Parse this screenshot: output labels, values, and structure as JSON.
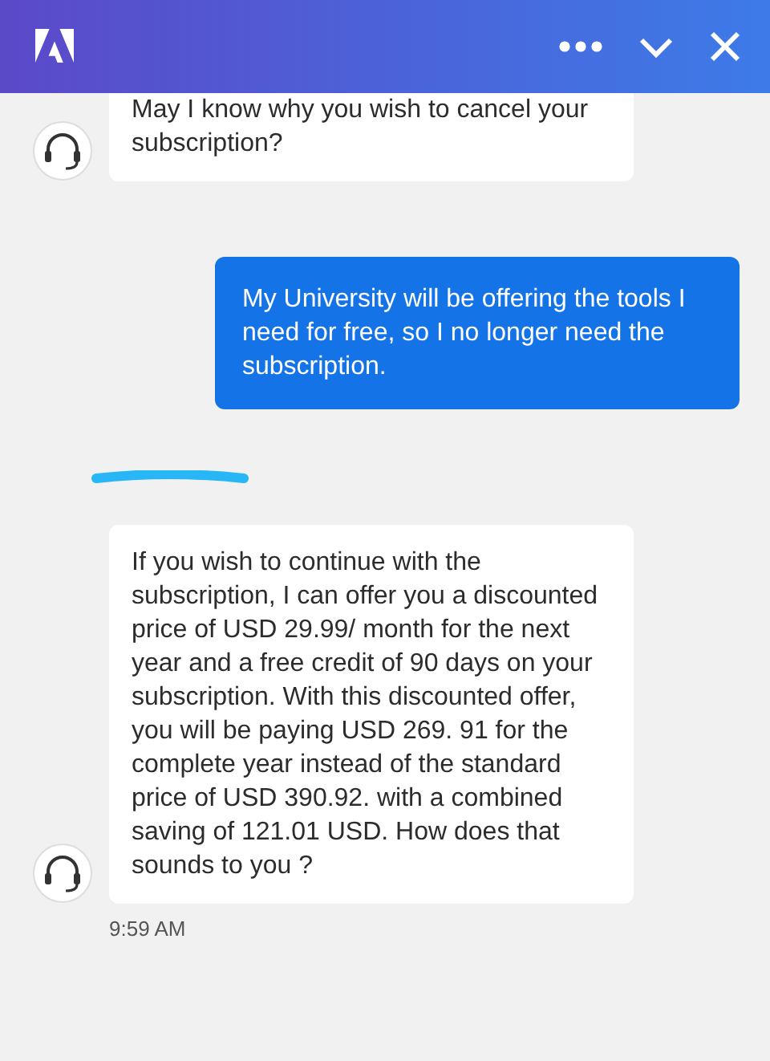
{
  "header": {
    "buttons": [
      {
        "kind": "more"
      },
      {
        "kind": "minimize"
      },
      {
        "kind": "close"
      }
    ]
  },
  "messages": [
    {
      "kind": "agent",
      "text": "May I know why you wish to cancel your subscription?",
      "cut_top": true
    },
    {
      "kind": "user",
      "text": "My University will be offering the tools I need for free, so I no longer need the subscription."
    },
    {
      "kind": "agent",
      "text": "If you wish to continue with the subscription, I can offer you a discounted price of USD 29.99/ month for the next year and a free credit of 90 days on your subscription. With this discounted offer, you will be paying USD 269. 91 for the complete year instead of the standard price of USD 390.92. with a combined saving of 121.01 USD. How does that sounds to you ?",
      "redacted_name": true,
      "time": "9:59 AM"
    }
  ]
}
